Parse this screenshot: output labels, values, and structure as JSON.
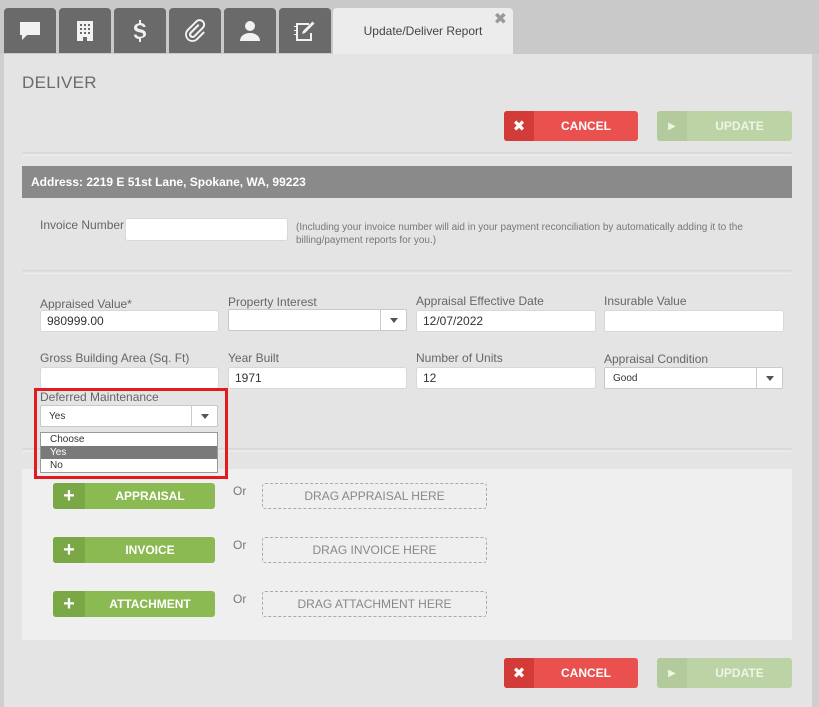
{
  "tabs": {
    "icons": [
      "chat-icon",
      "building-icon",
      "dollar-icon",
      "paperclip-icon",
      "user-icon",
      "notebook-edit-icon"
    ],
    "active_label": "Update/Deliver Report",
    "close_glyph": "✖"
  },
  "page": {
    "title": "DELIVER",
    "cancel_label": "CANCEL",
    "update_label": "UPDATE",
    "address": "Address: 2219 E 51st Lane, Spokane, WA, 99223"
  },
  "invoice": {
    "label": "Invoice Number",
    "value": "",
    "help": "(Including your invoice number will aid in your payment reconciliation by automatically adding it to the billing/payment reports for you.)"
  },
  "fields": {
    "appraised_value": {
      "label": "Appraised Value*",
      "value": "980999.00"
    },
    "property_interest": {
      "label": "Property Interest",
      "value": ""
    },
    "effective_date": {
      "label": "Appraisal Effective Date",
      "value": "12/07/2022"
    },
    "insurable_value": {
      "label": "Insurable Value",
      "value": ""
    },
    "gross_area": {
      "label": "Gross Building Area (Sq. Ft)",
      "value": ""
    },
    "year_built": {
      "label": "Year Built",
      "value": "1971"
    },
    "units": {
      "label": "Number of Units",
      "value": "12"
    },
    "condition": {
      "label": "Appraisal Condition",
      "value": "Good"
    },
    "deferred": {
      "label": "Deferred Maintenance",
      "value": "Yes",
      "options": [
        "Choose",
        "Yes",
        "No"
      ],
      "selected_option": "Yes"
    }
  },
  "uploads": {
    "or_text": "Or",
    "appraisal": {
      "button": "APPRAISAL",
      "drop": "DRAG APPRAISAL HERE"
    },
    "invoice": {
      "button": "INVOICE",
      "drop": "DRAG INVOICE HERE"
    },
    "attachment": {
      "button": "ATTACHMENT",
      "drop": "DRAG ATTACHMENT HERE"
    }
  },
  "colors": {
    "cancel": "#e9504e",
    "update_disabled": "#bcd3a6",
    "add_button": "#8bb952",
    "highlight": "#e21b23"
  }
}
